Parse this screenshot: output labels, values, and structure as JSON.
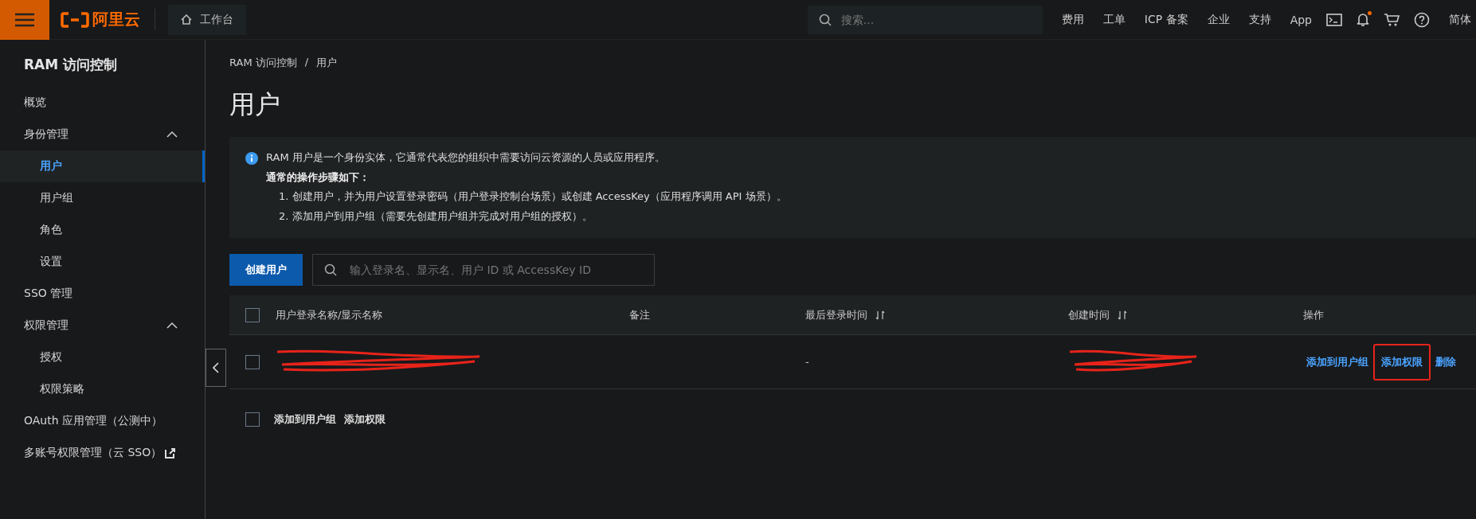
{
  "topbar": {
    "logo": "阿里云",
    "workbench": "工作台",
    "search_placeholder": "搜索...",
    "links": [
      "费用",
      "工单",
      "ICP 备案",
      "企业",
      "支持",
      "App"
    ],
    "notification_dot": true,
    "language": "简体"
  },
  "sidebar": {
    "title": "RAM 访问控制",
    "items": [
      {
        "kind": "link",
        "label": "概览",
        "selected": false
      },
      {
        "kind": "group",
        "label": "身份管理",
        "expanded": true,
        "children": [
          {
            "label": "用户",
            "selected": true
          },
          {
            "label": "用户组",
            "selected": false
          },
          {
            "label": "角色",
            "selected": false
          },
          {
            "label": "设置",
            "selected": false
          }
        ]
      },
      {
        "kind": "link",
        "label": "SSO 管理",
        "selected": false
      },
      {
        "kind": "group",
        "label": "权限管理",
        "expanded": true,
        "children": [
          {
            "label": "授权",
            "selected": false
          },
          {
            "label": "权限策略",
            "selected": false
          }
        ]
      },
      {
        "kind": "link",
        "label": "OAuth 应用管理（公测中）",
        "selected": false
      },
      {
        "kind": "external",
        "label": "多账号权限管理（云 SSO）",
        "selected": false
      }
    ]
  },
  "main": {
    "breadcrumb": [
      "RAM 访问控制",
      "用户"
    ],
    "breadcrumb_separator": "/",
    "title": "用户",
    "notice": {
      "text": "RAM 用户是一个身份实体，它通常代表您的组织中需要访问云资源的人员或应用程序。",
      "heading": "通常的操作步骤如下：",
      "steps": [
        "1. 创建用户，并为用户设置登录密码（用户登录控制台场景）或创建 AccessKey（应用程序调用 API 场景）。",
        "2. 添加用户到用户组（需要先创建用户组并完成对用户组的授权）。"
      ]
    },
    "create_button": "创建用户",
    "search_placeholder": "输入登录名、显示名、用户 ID 或 AccessKey ID",
    "table": {
      "header_checked": false,
      "columns": [
        {
          "label": "用户登录名称/显示名称",
          "sortable": false
        },
        {
          "label": "备注",
          "sortable": false
        },
        {
          "label": "最后登录时间",
          "sortable": true
        },
        {
          "label": "创建时间",
          "sortable": true
        },
        {
          "label": "操作",
          "sortable": false
        }
      ],
      "rows": [
        {
          "checked": false,
          "name_redacted": true,
          "last_login": "-",
          "created_redacted": true,
          "actions": [
            {
              "label": "添加到用户组",
              "highlighted": false
            },
            {
              "label": "添加权限",
              "highlighted": true
            },
            {
              "label": "删除",
              "highlighted": false
            }
          ]
        }
      ],
      "footer": {
        "checked": false,
        "actions": [
          "添加到用户组",
          "添加权限"
        ]
      }
    }
  }
}
